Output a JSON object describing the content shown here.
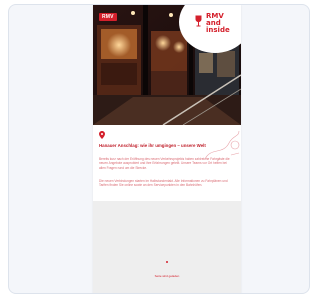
{
  "hero": {
    "brand_tag": "RMV",
    "logo_lines": [
      "RMV",
      "and",
      "inside"
    ],
    "accent": "#d4202c",
    "icon": "wine-glass-icon"
  },
  "article": {
    "pin_icon": "location-pin-icon",
    "headline": "Hanauer Anschlag: wie ihr umgingen – unsere Welt",
    "paragraph_1": "Bereits kurz nach der Eröffnung des neuen Verkehrsprojekts haben zahlreiche Fahrgäste die neuen Angebote ausprobiert und ihre Erfahrungen geteilt. Unsere Teams vor Ort helfen bei allen Fragen rund um die Strecke.",
    "paragraph_2": "Die neuen Verbindungen starten im Halbstundentakt. Alle Informationen zu Fahrplänen und Tarifen finden Sie online sowie an den Servicepunkten in den Bahnhöfen."
  },
  "footer": {
    "text": "Seite wird geladen"
  }
}
